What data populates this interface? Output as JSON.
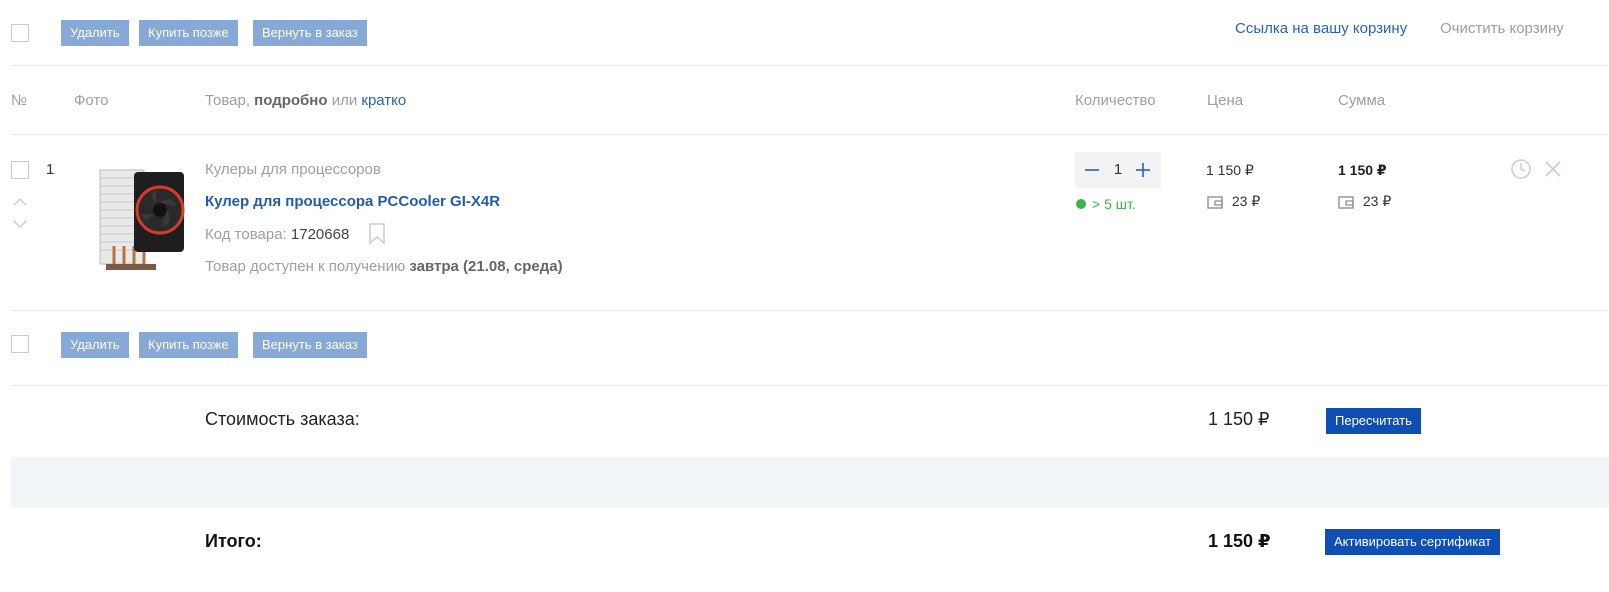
{
  "toolbar": {
    "delete": "Удалить",
    "buy_later": "Купить позже",
    "return_to_order": "Вернуть в заказ",
    "cart_link": "Ссылка на вашу корзину",
    "clear_cart": "Очистить корзину"
  },
  "table_header": {
    "number": "№",
    "photo": "Фото",
    "product_prefix": "Товар,",
    "product_detailed": "подробно",
    "product_or": "или",
    "product_brief": "кратко",
    "quantity": "Количество",
    "price": "Цена",
    "sum": "Сумма"
  },
  "item": {
    "index": "1",
    "category": "Кулеры для процессоров",
    "title": "Кулер для процессора PCCooler GI-X4R",
    "code_label": "Код товара:",
    "code": "1720668",
    "availability_prefix": "Товар доступен к получению",
    "availability_date": "завтра (21.08, среда)",
    "quantity": "1",
    "stock": "> 5 шт.",
    "price": "1 150 ₽",
    "price_bonus": "23 ₽",
    "sum": "1 150 ₽",
    "sum_bonus": "23 ₽"
  },
  "summary": {
    "order_cost_label": "Стоимость заказа:",
    "order_cost": "1 150 ₽",
    "recalc": "Пересчитать",
    "total_label": "Итого:",
    "total": "1 150 ₽",
    "activate_certificate": "Активировать сертификат"
  },
  "colors": {
    "accent": "#0f4fb3",
    "link": "#2a62b7",
    "light_button": "#87a9d8",
    "stock_green": "#3bb44a"
  }
}
